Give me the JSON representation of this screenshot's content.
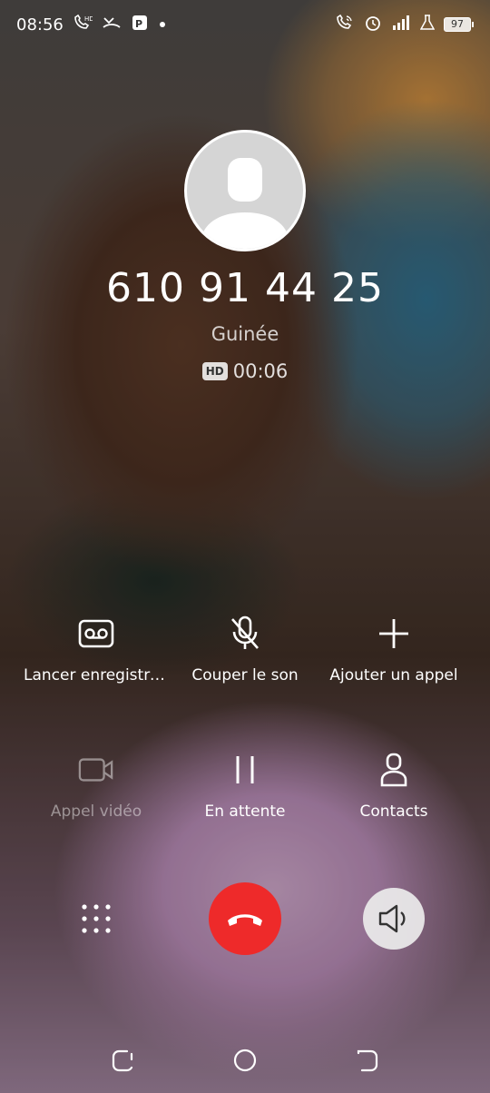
{
  "status_bar": {
    "time": "08:56",
    "battery": "97",
    "left_icons": [
      "hd-call-icon",
      "missed-call-icon",
      "app-icon",
      "dot-icon"
    ],
    "right_icons": [
      "wifi-call-icon",
      "alarm-icon",
      "signal-icon",
      "lab-icon"
    ]
  },
  "caller": {
    "number": "610 91 44 25",
    "location": "Guinée",
    "hd_label": "HD",
    "duration": "00:06"
  },
  "actions": {
    "record": "Lancer enregistre…",
    "mute": "Couper le son",
    "add_call": "Ajouter un appel",
    "video": "Appel vidéo",
    "hold": "En attente",
    "contacts": "Contacts"
  },
  "colors": {
    "end_call": "#ee2a2a",
    "speaker_bg": "#ebebeb"
  }
}
